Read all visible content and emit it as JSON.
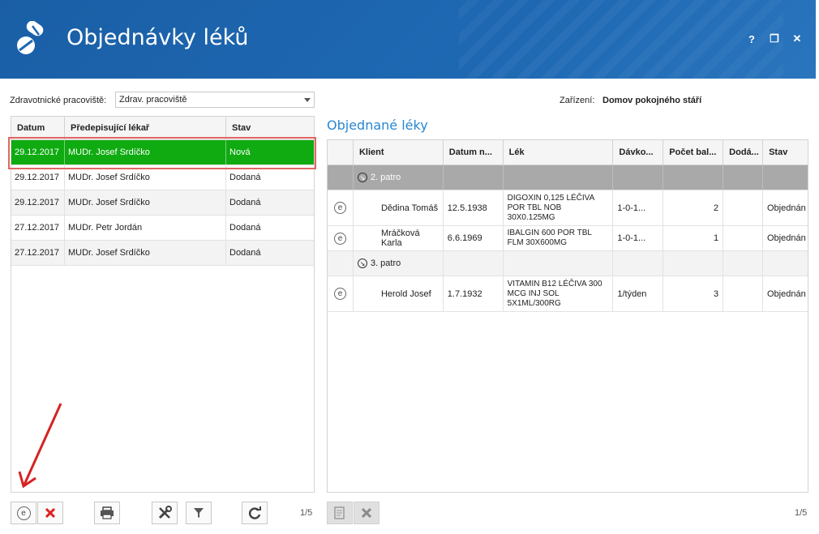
{
  "app": {
    "title": "Objednávky léků",
    "window_buttons": [
      "?",
      "❐",
      "✕"
    ]
  },
  "filter": {
    "workplace_label": "Zdravotnické pracoviště:",
    "workplace_value": "Zdrav. pracoviště",
    "facility_label": "Zařízení:",
    "facility_value": "Domov pokojného stáří"
  },
  "orders": {
    "columns": [
      "Datum",
      "Předepisující lékař",
      "Stav"
    ],
    "rows": [
      {
        "date": "29.12.2017",
        "doctor": "MUDr. Josef Srdíčko",
        "status": "Nová"
      },
      {
        "date": "29.12.2017",
        "doctor": "MUDr. Josef Srdíčko",
        "status": "Dodaná"
      },
      {
        "date": "29.12.2017",
        "doctor": "MUDr. Josef Srdíčko",
        "status": "Dodaná"
      },
      {
        "date": "27.12.2017",
        "doctor": "MUDr. Petr Jordán",
        "status": "Dodaná"
      },
      {
        "date": "27.12.2017",
        "doctor": "MUDr. Josef Srdíčko",
        "status": "Dodaná"
      }
    ],
    "pager": "1/5"
  },
  "ordered": {
    "title": "Objednané léky",
    "columns": [
      "Klient",
      "Datum n...",
      "Lék",
      "Dávko...",
      "Počet bal...",
      "Dodá...",
      "Stav"
    ],
    "groups": [
      {
        "label": "2. patro",
        "rows": [
          {
            "client": "Dědina Tomáš",
            "birth": "12.5.1938",
            "drug": "DIGOXIN 0,125 LÉČIVA POR TBL NOB 30X0.125MG",
            "dose": "1-0-1...",
            "count": "2",
            "delivered": "",
            "status": "Objednán"
          },
          {
            "client": "Mráčková Karla",
            "birth": "6.6.1969",
            "drug": "IBALGIN 600 POR TBL FLM 30X600MG",
            "dose": "1-0-1...",
            "count": "1",
            "delivered": "",
            "status": "Objednán"
          }
        ]
      },
      {
        "label": "3. patro",
        "rows": [
          {
            "client": "Herold Josef",
            "birth": "1.7.1932",
            "drug": "VITAMIN B12 LÉČIVA 300 MCG INJ SOL 5X1ML/300RG",
            "dose": "1/týden",
            "count": "3",
            "delivered": "",
            "status": "Objednán"
          }
        ]
      }
    ],
    "pager": "1/5"
  },
  "icons": {
    "new_order": "e-circle-icon",
    "delete": "close-icon",
    "print": "printer-icon",
    "settings": "tools-icon",
    "filter": "filter-icon",
    "refresh": "refresh-icon",
    "edit": "document-edit-icon",
    "cancel": "close-icon"
  },
  "colors": {
    "header": "#1e68b3",
    "selected_row": "#0fab11",
    "title_blue": "#2787d3",
    "delete_red": "#e0201f",
    "annotation_red": "#d62222"
  }
}
